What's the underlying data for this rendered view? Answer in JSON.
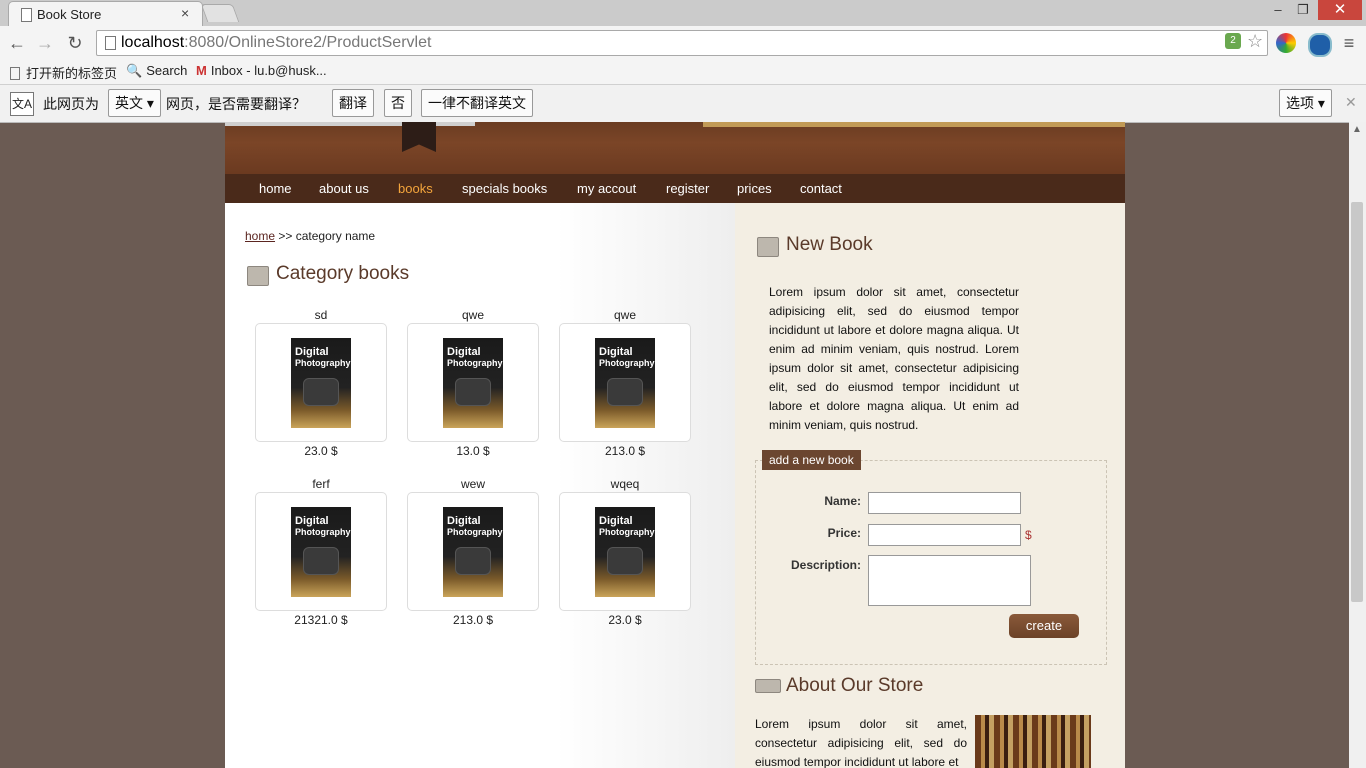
{
  "browser": {
    "tab_title": "Book Store",
    "tab_close": "×",
    "url_host": "localhost",
    "url_rest": ":8080/OnlineStore2/ProductServlet",
    "ext_badge": "2",
    "window": {
      "min": "–",
      "restore": "❐",
      "close": "✕"
    }
  },
  "bookmarks": [
    {
      "label": "打开新的标签页",
      "icon": "page-icon"
    },
    {
      "label": "Search",
      "icon": "search-icon"
    },
    {
      "label": "Inbox - lu.b@husk...",
      "icon": "gmail-icon"
    }
  ],
  "translate": {
    "prefix": "此网页为",
    "language": "英文",
    "question": "网页，是否需要翻译？",
    "translate_btn": "翻译",
    "no_btn": "否",
    "never_btn": "一律不翻译英文",
    "options_btn": "选项",
    "close": "✕"
  },
  "nav": [
    "home",
    "about us",
    "books",
    "specials books",
    "my accout",
    "register",
    "prices",
    "contact"
  ],
  "breadcrumb": {
    "home": "home",
    "rest": " >> category name"
  },
  "category_title": "Category books",
  "products": [
    {
      "name": "sd",
      "price": "23.0 $"
    },
    {
      "name": "qwe",
      "price": "13.0 $"
    },
    {
      "name": "qwe",
      "price": "213.0 $"
    },
    {
      "name": "ferf",
      "price": "21321.0 $"
    },
    {
      "name": "wew",
      "price": "213.0 $"
    },
    {
      "name": "wqeq",
      "price": "23.0 $"
    }
  ],
  "cover": {
    "line1": "Digital",
    "line2": "Photography"
  },
  "new_book": {
    "title": "New Book",
    "text": "Lorem ipsum dolor sit amet, consectetur adipisicing elit, sed do eiusmod tempor incididunt ut labore et dolore magna aliqua. Ut enim ad minim veniam, quis nostrud. Lorem ipsum dolor sit amet, consectetur adipisicing elit, sed do eiusmod tempor incididunt ut labore et dolore magna aliqua. Ut enim ad minim veniam, quis nostrud.",
    "legend": "add a new book",
    "name_label": "Name:",
    "price_label": "Price:",
    "price_unit": "$",
    "desc_label": "Description:",
    "create_btn": "create"
  },
  "about": {
    "title": "About Our Store",
    "text": "Lorem ipsum dolor sit amet, consectetur adipisicing elit, sed do eiusmod tempor incididunt ut labore et"
  }
}
